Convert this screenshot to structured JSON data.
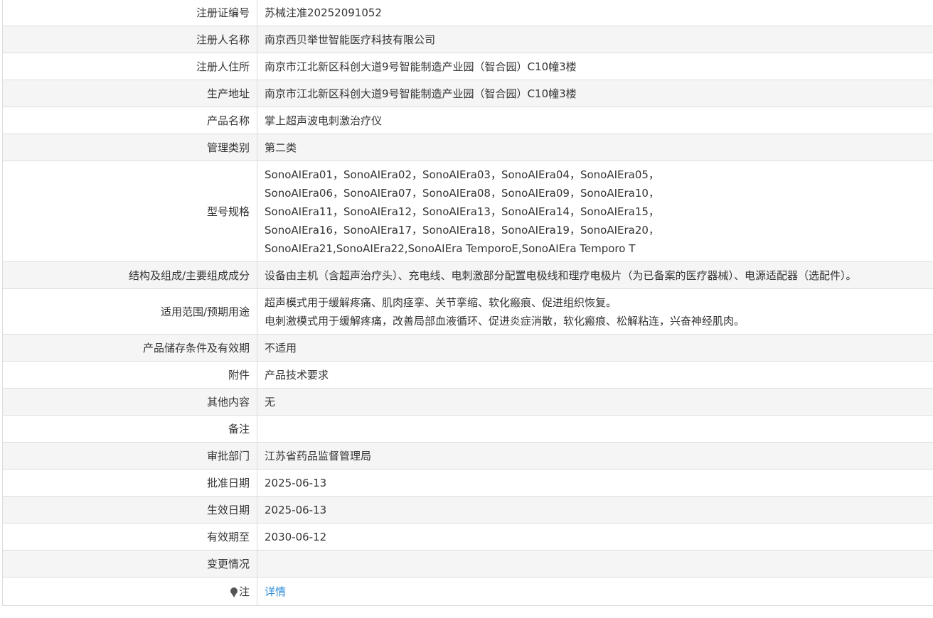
{
  "record": {
    "rows": [
      {
        "label": "注册证编号",
        "value": "苏械注准20252091052"
      },
      {
        "label": "注册人名称",
        "value": "南京西贝举世智能医疗科技有限公司"
      },
      {
        "label": "注册人住所",
        "value": "南京市江北新区科创大道9号智能制造产业园（智合园）C10幢3楼"
      },
      {
        "label": "生产地址",
        "value": "南京市江北新区科创大道9号智能制造产业园（智合园）C10幢3楼"
      },
      {
        "label": "产品名称",
        "value": "掌上超声波电刺激治疗仪"
      },
      {
        "label": "管理类别",
        "value": "第二类"
      },
      {
        "label": "型号规格",
        "lines": [
          "SonoAIEra01，SonoAIEra02，SonoAIEra03，SonoAIEra04，SonoAIEra05，",
          "SonoAIEra06，SonoAIEra07，SonoAIEra08，SonoAIEra09，SonoAIEra10，",
          "SonoAIEra11，SonoAIEra12，SonoAIEra13，SonoAIEra14，SonoAIEra15，",
          "SonoAIEra16，SonoAIEra17，SonoAIEra18，SonoAIEra19，SonoAIEra20，",
          "SonoAIEra21,SonoAIEra22,SonoAIEra TemporoE,SonoAIEra Temporo T"
        ]
      },
      {
        "label": "结构及组成/主要组成成分",
        "value": "设备由主机（含超声治疗头）、充电线、电刺激部分配置电极线和理疗电极片（为已备案的医疗器械）、电源适配器（选配件）。"
      },
      {
        "label": "适用范围/预期用途",
        "lines": [
          "超声模式用于缓解疼痛、肌肉痉挛、关节挛缩、软化瘢痕、促进组织恢复。",
          "电刺激模式用于缓解疼痛，改善局部血液循环、促进炎症消散，软化瘢痕、松解粘连，兴奋神经肌肉。"
        ]
      },
      {
        "label": "产品储存条件及有效期",
        "value": "不适用"
      },
      {
        "label": "附件",
        "value": "产品技术要求"
      },
      {
        "label": "其他内容",
        "value": "无"
      },
      {
        "label": "备注",
        "value": ""
      },
      {
        "label": "审批部门",
        "value": "江苏省药品监督管理局"
      },
      {
        "label": "批准日期",
        "value": "2025-06-13"
      },
      {
        "label": "生效日期",
        "value": "2025-06-13"
      },
      {
        "label": "有效期至",
        "value": "2030-06-12"
      },
      {
        "label": "变更情况",
        "value": ""
      },
      {
        "label": "注",
        "icon": "lightbulb-icon",
        "value": "详情"
      }
    ]
  },
  "colors": {
    "border": "#dddddd",
    "shaded_row": "#f5f5f5",
    "text": "#333333",
    "link": "#2a8bd8"
  }
}
